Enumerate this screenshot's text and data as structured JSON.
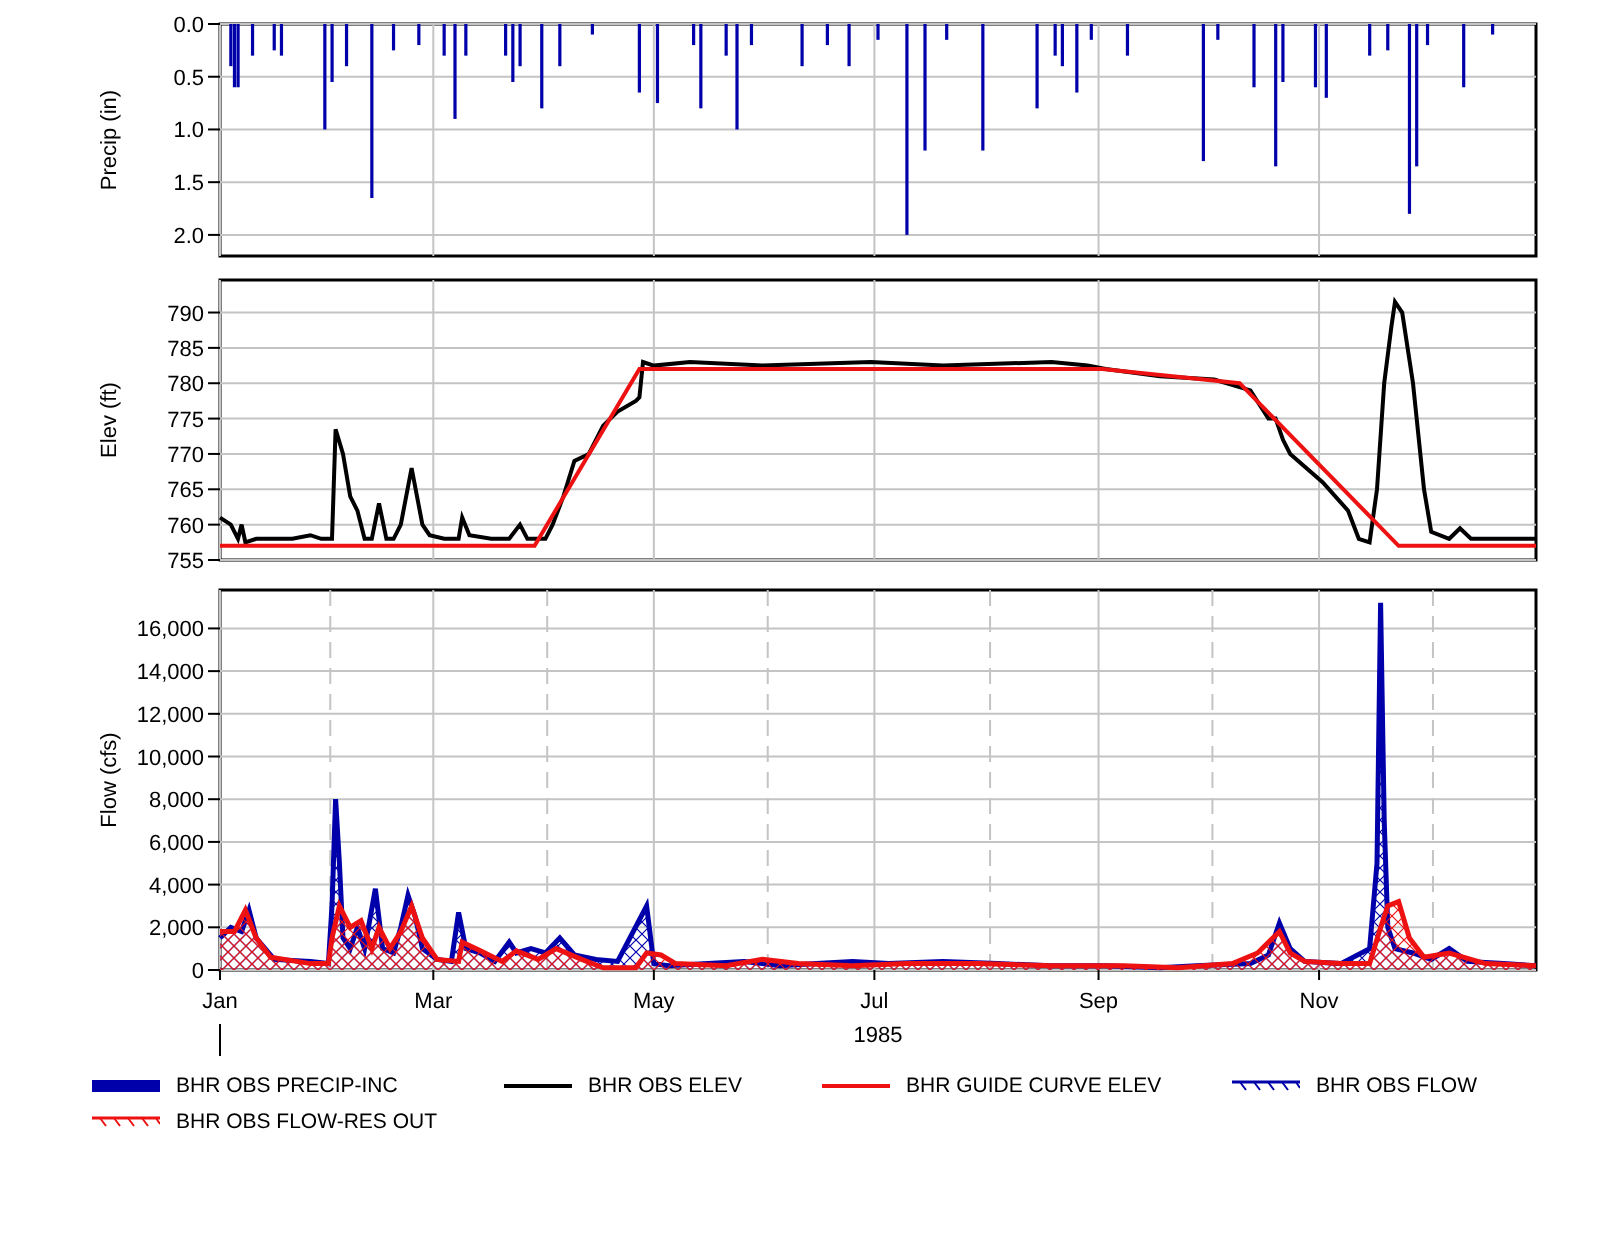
{
  "charts": [
    {
      "chart_data": {
        "type": "bar",
        "grid": true,
        "ylabel": "Precip (in)",
        "xlim": [
          "1985-01-01",
          "1985-12-31"
        ],
        "ylim": [
          2.2,
          0
        ],
        "yticks": [
          {
            "value": 0,
            "label": "0.0"
          },
          {
            "value": 0.5,
            "label": "0.5"
          },
          {
            "value": 1,
            "label": "1.0"
          },
          {
            "value": 1.5,
            "label": "1.5"
          },
          {
            "value": 2,
            "label": "2.0"
          }
        ],
        "x": [
          "1985-01-04",
          "1985-01-05",
          "1985-01-06",
          "1985-01-10",
          "1985-01-16",
          "1985-01-18",
          "1985-01-30",
          "1985-02-01",
          "1985-02-05",
          "1985-02-12",
          "1985-02-18",
          "1985-02-25",
          "1985-03-04",
          "1985-03-07",
          "1985-03-10",
          "1985-03-21",
          "1985-03-23",
          "1985-03-25",
          "1985-03-31",
          "1985-04-05",
          "1985-04-14",
          "1985-04-27",
          "1985-05-02",
          "1985-05-12",
          "1985-05-14",
          "1985-05-21",
          "1985-05-24",
          "1985-05-28",
          "1985-06-11",
          "1985-06-18",
          "1985-06-24",
          "1985-07-02",
          "1985-07-10",
          "1985-07-15",
          "1985-07-21",
          "1985-07-31",
          "1985-08-15",
          "1985-08-20",
          "1985-08-22",
          "1985-08-26",
          "1985-08-30",
          "1985-09-09",
          "1985-09-30",
          "1985-10-04",
          "1985-10-14",
          "1985-10-20",
          "1985-10-22",
          "1985-10-31",
          "1985-11-03",
          "1985-11-15",
          "1985-11-20",
          "1985-11-26",
          "1985-11-28",
          "1985-12-01",
          "1985-12-11",
          "1985-12-19"
        ],
        "series": [
          {
            "name": "BHR OBS PRECIP-INC",
            "color": "#0000aa",
            "values": [
              0.4,
              0.6,
              0.6,
              0.3,
              0.25,
              0.3,
              1.0,
              0.55,
              0.4,
              1.65,
              0.25,
              0.2,
              0.3,
              0.9,
              0.3,
              0.3,
              0.55,
              0.4,
              0.8,
              0.4,
              0.1,
              0.65,
              0.75,
              0.2,
              0.8,
              0.3,
              1.0,
              0.2,
              0.4,
              0.2,
              0.4,
              0.15,
              2.0,
              1.2,
              0.15,
              1.2,
              0.8,
              0.3,
              0.4,
              0.65,
              0.15,
              0.3,
              1.3,
              0.15,
              0.6,
              1.35,
              0.55,
              0.6,
              0.7,
              0.3,
              0.25,
              1.8,
              1.35,
              0.2,
              0.6,
              0.1
            ]
          }
        ]
      }
    },
    {
      "chart_data": {
        "type": "line",
        "grid": true,
        "ylabel": "Elev (ft)",
        "xlim": [
          "1985-01-01",
          "1985-12-31"
        ],
        "ylim": [
          755,
          794.6
        ],
        "yticks": [
          {
            "value": 755,
            "label": "755"
          },
          {
            "value": 760,
            "label": "760"
          },
          {
            "value": 765,
            "label": "765"
          },
          {
            "value": 770,
            "label": "770"
          },
          {
            "value": 775,
            "label": "775"
          },
          {
            "value": 780,
            "label": "780"
          },
          {
            "value": 785,
            "label": "785"
          },
          {
            "value": 790,
            "label": "790"
          }
        ],
        "series": [
          {
            "name": "BHR OBS ELEV",
            "color": "#000000",
            "x": [
              "1985-01-01",
              "1985-01-04",
              "1985-01-06",
              "1985-01-07",
              "1985-01-08",
              "1985-01-11",
              "1985-01-21",
              "1985-01-26",
              "1985-01-29",
              "1985-02-01",
              "1985-02-02",
              "1985-02-04",
              "1985-02-06",
              "1985-02-08",
              "1985-02-10",
              "1985-02-12",
              "1985-02-14",
              "1985-02-16",
              "1985-02-18",
              "1985-02-20",
              "1985-02-23",
              "1985-02-26",
              "1985-02-28",
              "1985-03-04",
              "1985-03-08",
              "1985-03-09",
              "1985-03-11",
              "1985-03-17",
              "1985-03-22",
              "1985-03-25",
              "1985-03-27",
              "1985-03-30",
              "1985-04-01",
              "1985-04-03",
              "1985-04-06",
              "1985-04-09",
              "1985-04-13",
              "1985-04-17",
              "1985-04-21",
              "1985-04-26",
              "1985-04-27",
              "1985-04-28",
              "1985-05-01",
              "1985-05-11",
              "1985-05-31",
              "1985-06-30",
              "1985-07-20",
              "1985-08-19",
              "1985-08-29",
              "1985-09-03",
              "1985-09-18",
              "1985-10-03",
              "1985-10-13",
              "1985-10-18",
              "1985-10-20",
              "1985-10-22",
              "1985-10-24",
              "1985-11-02",
              "1985-11-09",
              "1985-11-12",
              "1985-11-15",
              "1985-11-17",
              "1985-11-19",
              "1985-11-21",
              "1985-11-22",
              "1985-11-24",
              "1985-11-27",
              "1985-11-30",
              "1985-12-02",
              "1985-12-07",
              "1985-12-10",
              "1985-12-13",
              "1985-12-22",
              "1985-12-31"
            ],
            "values": [
              761,
              760,
              758,
              760,
              757.5,
              758,
              758,
              758.5,
              758,
              758,
              773.5,
              770,
              764,
              762,
              758,
              758,
              763,
              758,
              758,
              760,
              768,
              760,
              758.5,
              758,
              758,
              761,
              758.5,
              758,
              758,
              760,
              758,
              758,
              758,
              760,
              764,
              769,
              770,
              774,
              776,
              777.5,
              778,
              783,
              782.5,
              783,
              782.5,
              783,
              782.5,
              783,
              782.5,
              782,
              781,
              780.5,
              779,
              775,
              775,
              772,
              770,
              766,
              762,
              758,
              757.5,
              765,
              780,
              788,
              791.5,
              790,
              780,
              765,
              759,
              758,
              759.5,
              758,
              758,
              758
            ]
          },
          {
            "name": "BHR GUIDE CURVE ELEV",
            "color": "#ee1111",
            "x": [
              "1985-01-01",
              "1985-03-29",
              "1985-04-27",
              "1985-09-02",
              "1985-10-10",
              "1985-11-23",
              "1985-12-31"
            ],
            "values": [
              757,
              757,
              782,
              782,
              780,
              757,
              757
            ]
          }
        ]
      }
    },
    {
      "chart_data": {
        "type": "area",
        "grid": true,
        "ylabel": "Flow (cfs)",
        "xlabel": "1985",
        "xlim": [
          "1985-01-01",
          "1985-12-31"
        ],
        "ylim": [
          0,
          17800
        ],
        "xticks": [
          {
            "value": "1985-01-01",
            "label": "Jan"
          },
          {
            "value": "1985-03-01",
            "label": "Mar"
          },
          {
            "value": "1985-05-01",
            "label": "May"
          },
          {
            "value": "1985-07-01",
            "label": "Jul"
          },
          {
            "value": "1985-09-01",
            "label": "Sep"
          },
          {
            "value": "1985-11-01",
            "label": "Nov"
          }
        ],
        "yticks": [
          {
            "value": 0,
            "label": "0"
          },
          {
            "value": 2000,
            "label": "2,000"
          },
          {
            "value": 4000,
            "label": "4,000"
          },
          {
            "value": 6000,
            "label": "6,000"
          },
          {
            "value": 8000,
            "label": "8,000"
          },
          {
            "value": 10000,
            "label": "10,000"
          },
          {
            "value": 12000,
            "label": "12,000"
          },
          {
            "value": 14000,
            "label": "14,000"
          },
          {
            "value": 16000,
            "label": "16,000"
          }
        ],
        "series": [
          {
            "name": "BHR OBS FLOW",
            "color": "#0000aa",
            "x": [
              "1985-01-01",
              "1985-01-04",
              "1985-01-07",
              "1985-01-09",
              "1985-01-11",
              "1985-01-16",
              "1985-01-26",
              "1985-01-31",
              "1985-02-01",
              "1985-02-02",
              "1985-02-03",
              "1985-02-04",
              "1985-02-06",
              "1985-02-08",
              "1985-02-10",
              "1985-02-13",
              "1985-02-15",
              "1985-02-18",
              "1985-02-20",
              "1985-02-22",
              "1985-02-24",
              "1985-02-26",
              "1985-03-02",
              "1985-03-06",
              "1985-03-08",
              "1985-03-10",
              "1985-03-14",
              "1985-03-18",
              "1985-03-22",
              "1985-03-24",
              "1985-03-28",
              "1985-04-01",
              "1985-04-05",
              "1985-04-09",
              "1985-04-15",
              "1985-04-21",
              "1985-04-29",
              "1985-05-01",
              "1985-05-05",
              "1985-05-16",
              "1985-05-26",
              "1985-06-05",
              "1985-06-15",
              "1985-06-25",
              "1985-07-05",
              "1985-07-20",
              "1985-08-04",
              "1985-08-19",
              "1985-09-03",
              "1985-09-18",
              "1985-09-28",
              "1985-10-13",
              "1985-10-18",
              "1985-10-21",
              "1985-10-24",
              "1985-10-28",
              "1985-11-07",
              "1985-11-15",
              "1985-11-17",
              "1985-11-18",
              "1985-11-19",
              "1985-11-20",
              "1985-11-22",
              "1985-11-27",
              "1985-12-02",
              "1985-12-07",
              "1985-12-12",
              "1985-12-22",
              "1985-12-31"
            ],
            "values": [
              1500,
              2000,
              1800,
              2800,
              1500,
              500,
              400,
              300,
              3000,
              8000,
              5000,
              1500,
              1000,
              2000,
              1000,
              3800,
              1000,
              800,
              2000,
              3500,
              2500,
              1000,
              500,
              400,
              2700,
              1000,
              800,
              400,
              1300,
              800,
              1000,
              800,
              1500,
              700,
              500,
              400,
              3000,
              300,
              200,
              300,
              400,
              200,
              300,
              400,
              300,
              400,
              300,
              200,
              200,
              100,
              200,
              300,
              700,
              2200,
              1000,
              400,
              300,
              1000,
              5000,
              17200,
              7000,
              2000,
              1000,
              800,
              500,
              1000,
              400,
              300,
              200
            ]
          },
          {
            "name": "BHR OBS FLOW-RES OUT",
            "color": "#ee1111",
            "x": [
              "1985-01-01",
              "1985-01-05",
              "1985-01-08",
              "1985-01-11",
              "1985-01-15",
              "1985-01-26",
              "1985-01-31",
              "1985-02-01",
              "1985-02-03",
              "1985-02-06",
              "1985-02-09",
              "1985-02-12",
              "1985-02-14",
              "1985-02-17",
              "1985-02-20",
              "1985-02-23",
              "1985-02-26",
              "1985-03-02",
              "1985-03-08",
              "1985-03-09",
              "1985-03-14",
              "1985-03-20",
              "1985-03-24",
              "1985-03-30",
              "1985-04-04",
              "1985-04-11",
              "1985-04-17",
              "1985-04-26",
              "1985-04-29",
              "1985-05-03",
              "1985-05-07",
              "1985-05-21",
              "1985-05-31",
              "1985-06-10",
              "1985-06-25",
              "1985-07-10",
              "1985-07-30",
              "1985-08-19",
              "1985-09-08",
              "1985-09-23",
              "1985-10-08",
              "1985-10-15",
              "1985-10-21",
              "1985-10-24",
              "1985-10-28",
              "1985-11-07",
              "1985-11-15",
              "1985-11-18",
              "1985-11-20",
              "1985-11-23",
              "1985-11-26",
              "1985-11-30",
              "1985-12-07",
              "1985-12-17",
              "1985-12-31"
            ],
            "values": [
              1800,
              1800,
              2800,
              1500,
              600,
              300,
              300,
              1500,
              3000,
              2000,
              2300,
              1000,
              2000,
              1000,
              1800,
              3000,
              1500,
              500,
              400,
              1300,
              900,
              400,
              900,
              500,
              1000,
              500,
              100,
              100,
              800,
              700,
              300,
              200,
              500,
              300,
              200,
              300,
              300,
              200,
              200,
              100,
              300,
              800,
              1800,
              800,
              400,
              300,
              300,
              2000,
              3000,
              3200,
              1500,
              600,
              800,
              300,
              200
            ]
          }
        ]
      }
    }
  ]
}
